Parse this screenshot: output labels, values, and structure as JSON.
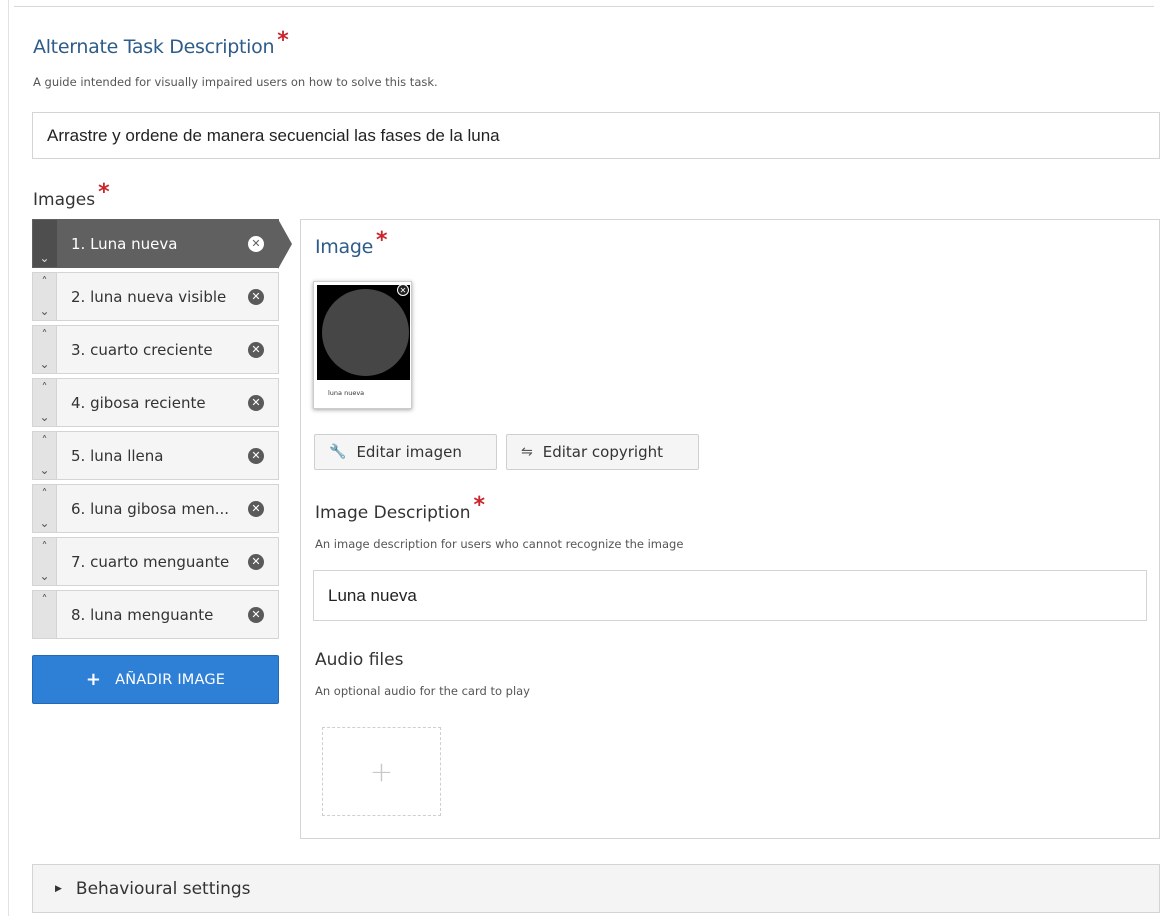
{
  "alt_task": {
    "title": "Alternate Task Description",
    "required_mark": "*",
    "help": "A guide intended for visually impaired users on how to solve this task.",
    "value": "Arrastre y ordene de manera secuencial las fases de la luna"
  },
  "images": {
    "label": "Images",
    "required_mark": "*",
    "items": [
      {
        "label": "1. Luna nueva"
      },
      {
        "label": "2. luna nueva visible"
      },
      {
        "label": "3. cuarto creciente"
      },
      {
        "label": "4. gibosa reciente"
      },
      {
        "label": "5. luna llena"
      },
      {
        "label": "6. luna gibosa men..."
      },
      {
        "label": "7. cuarto menguante"
      },
      {
        "label": "8. luna menguante"
      }
    ],
    "active_index": 0,
    "add_button": "AÑADIR IMAGE"
  },
  "editor": {
    "image_title": "Image",
    "required_mark": "*",
    "thumbnail_caption": "luna nueva",
    "edit_image_button": "Editar imagen",
    "edit_copyright_button": "Editar copyright",
    "description_title": "Image Description",
    "description_help": "An image description for users who cannot recognize the image",
    "description_value": "Luna nueva",
    "audio_title": "Audio files",
    "audio_help": "An optional audio for the card to play",
    "audio_add_symbol": "+"
  },
  "behavioural": {
    "label": "Behavioural settings"
  },
  "colors": {
    "title_blue": "#2e5c8a",
    "required_red": "#c9252c",
    "add_button_blue": "#2e7fd6",
    "active_item": "#606060"
  }
}
